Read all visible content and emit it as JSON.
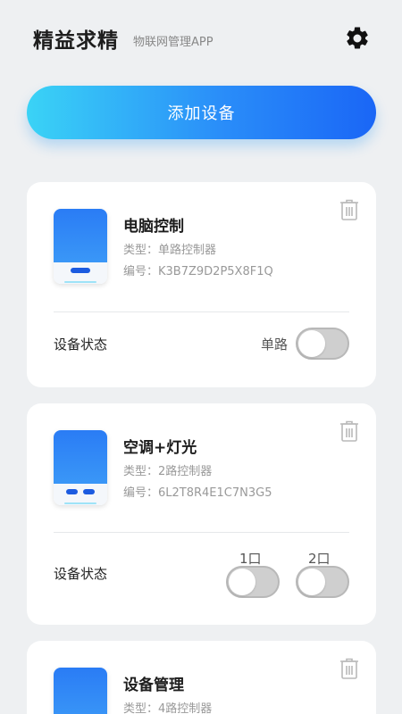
{
  "header": {
    "title": "精益求精",
    "subtitle": "物联网管理APP",
    "settings_icon": "gear-icon"
  },
  "add_button": {
    "label": "添加设备"
  },
  "devices": [
    {
      "name": "电脑控制",
      "type": "类型：单路控制器",
      "code": "编号：K3B7Z9D2P5X8F1Q",
      "status_label": "设备状态",
      "switches": [
        {
          "label": "单路",
          "on": false
        }
      ]
    },
    {
      "name": "空调+灯光",
      "type": "类型：2路控制器",
      "code": "编号：6L2T8R4E1C7N3G5",
      "status_label": "设备状态",
      "switches": [
        {
          "label": "1口",
          "on": false
        },
        {
          "label": "2口",
          "on": false
        }
      ]
    },
    {
      "name": "设备管理",
      "type": "类型：4路控制器"
    }
  ],
  "colors": {
    "accent_start": "#3ad3f6",
    "accent_end": "#1a66f6",
    "background": "#eef0f2"
  }
}
